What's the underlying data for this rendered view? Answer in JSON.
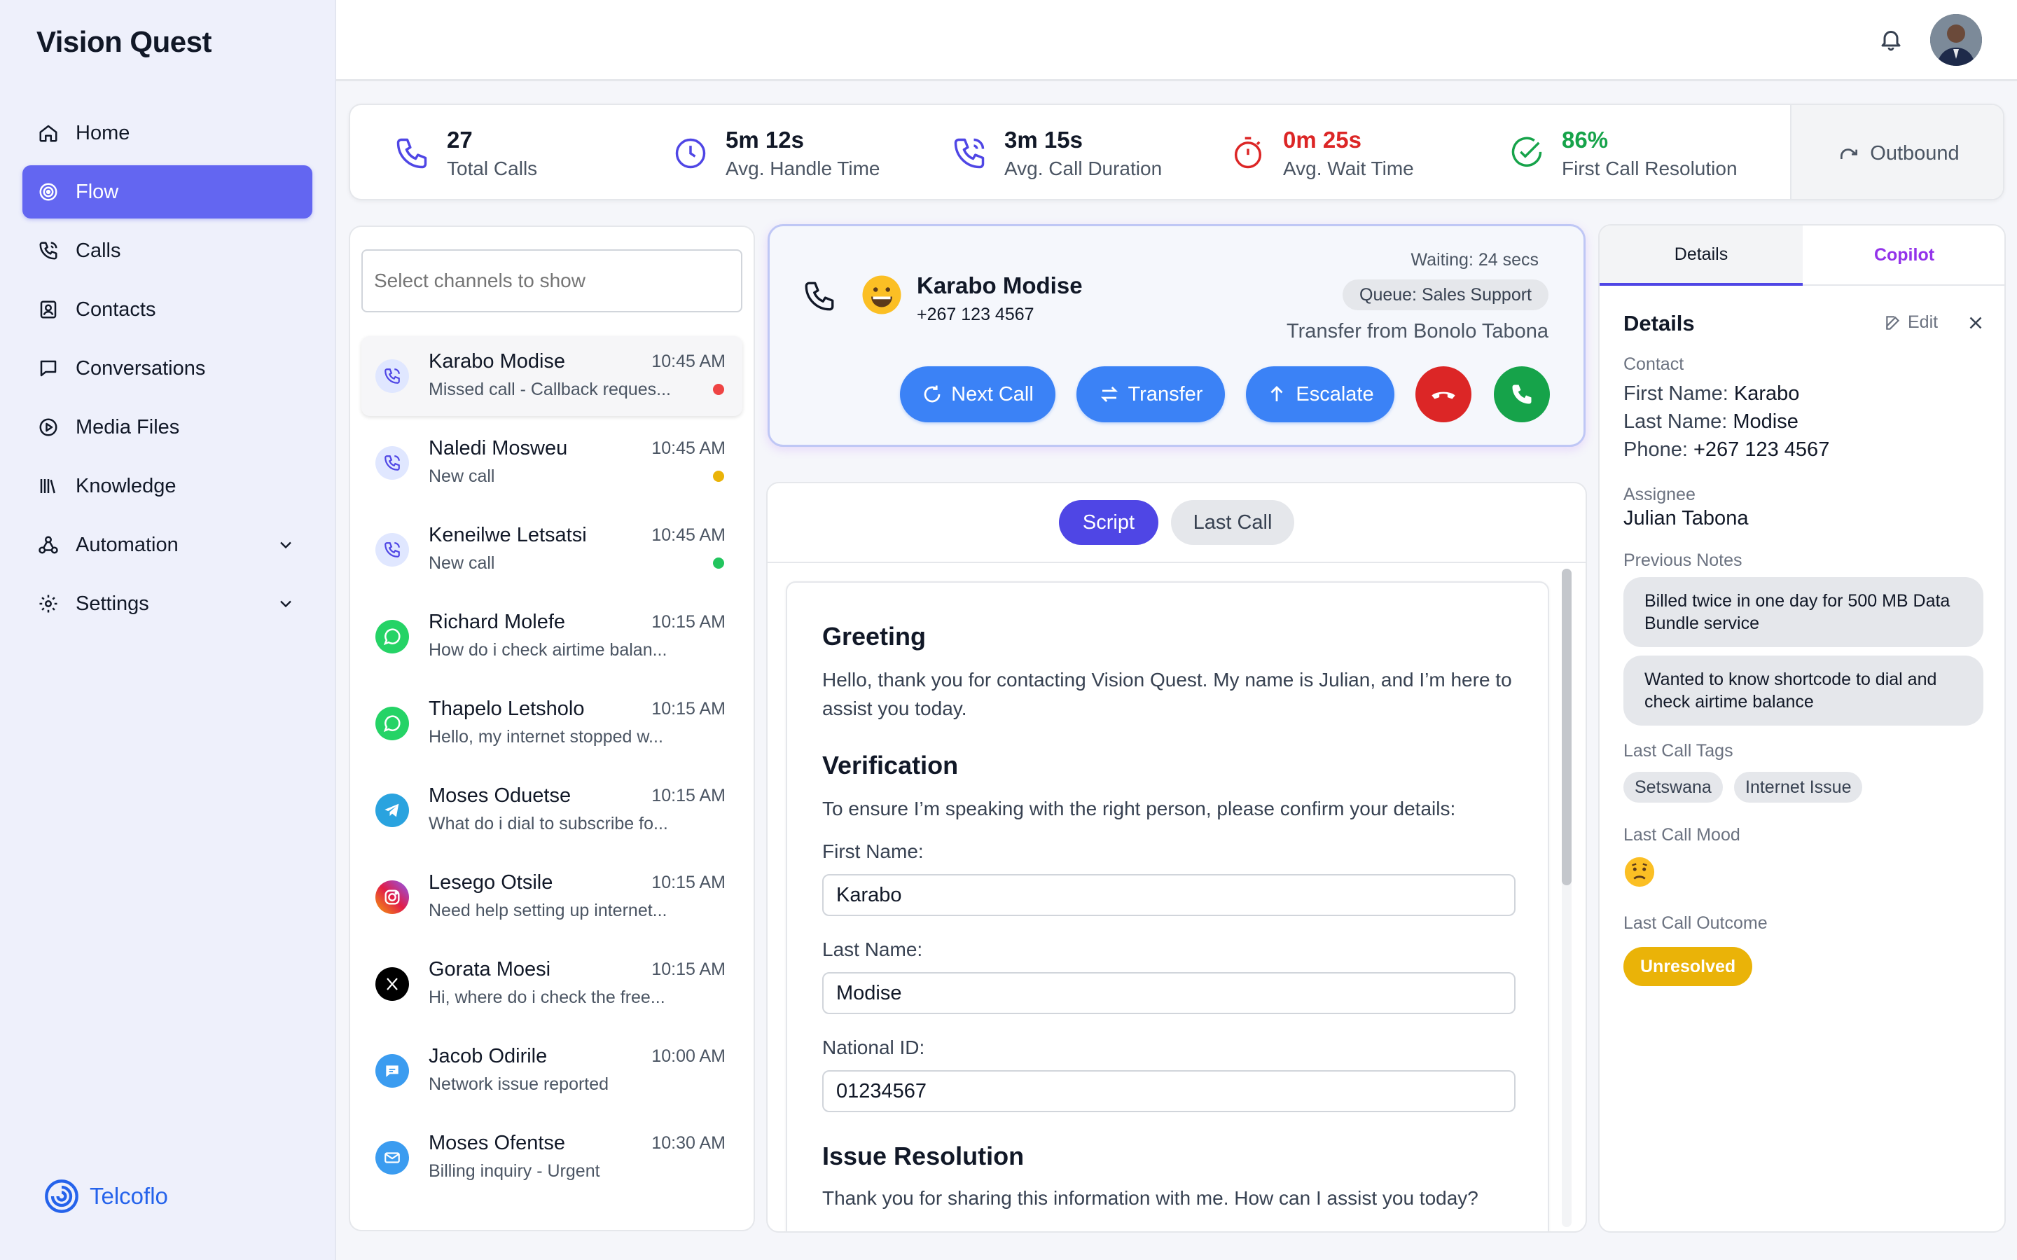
{
  "app": {
    "brand": "Vision Quest",
    "footer_brand": "Telcoflo"
  },
  "nav": [
    {
      "label": "Home",
      "icon": "home-icon"
    },
    {
      "label": "Flow",
      "icon": "flow-icon",
      "active": true
    },
    {
      "label": "Calls",
      "icon": "phone-icon"
    },
    {
      "label": "Contacts",
      "icon": "contacts-icon"
    },
    {
      "label": "Conversations",
      "icon": "chat-icon"
    },
    {
      "label": "Media Files",
      "icon": "play-icon"
    },
    {
      "label": "Knowledge",
      "icon": "library-icon"
    },
    {
      "label": "Automation",
      "icon": "automation-icon",
      "has_chevron": true
    },
    {
      "label": "Settings",
      "icon": "gear-icon",
      "has_chevron": true
    }
  ],
  "stats": [
    {
      "value": "27",
      "label": "Total Calls",
      "icon": "phone-icon",
      "color": "#4f46e5"
    },
    {
      "value": "5m 12s",
      "label": "Avg. Handle Time",
      "icon": "clock-icon",
      "color": "#4f46e5"
    },
    {
      "value": "3m 15s",
      "label": "Avg. Call Duration",
      "icon": "phone-call-icon",
      "color": "#4f46e5"
    },
    {
      "value": "0m 25s",
      "label": "Avg. Wait Time",
      "icon": "timer-icon",
      "color": "#dc2626"
    },
    {
      "value": "86%",
      "label": "First Call Resolution",
      "icon": "check-circle-icon",
      "color": "#16a34a"
    }
  ],
  "outbound_label": "Outbound",
  "channels": {
    "search_placeholder": "Select channels to show",
    "items": [
      {
        "name": "Karabo Modise",
        "time": "10:45 AM",
        "preview": "Missed call - Callback reques...",
        "channel": "call",
        "dot": "#ef4444",
        "selected": true
      },
      {
        "name": "Naledi Mosweu",
        "time": "10:45 AM",
        "preview": "New call",
        "channel": "call",
        "dot": "#eab308"
      },
      {
        "name": "Keneilwe Letsatsi",
        "time": "10:45 AM",
        "preview": "New call",
        "channel": "call",
        "dot": "#22c55e"
      },
      {
        "name": "Richard Molefe",
        "time": "10:15 AM",
        "preview": "How do i check airtime balan...",
        "channel": "whatsapp"
      },
      {
        "name": "Thapelo Letsholo",
        "time": "10:15 AM",
        "preview": "Hello, my internet stopped w...",
        "channel": "whatsapp"
      },
      {
        "name": "Moses Oduetse",
        "time": "10:15 AM",
        "preview": "What do i dial to subscribe fo...",
        "channel": "telegram"
      },
      {
        "name": "Lesego Otsile",
        "time": "10:15 AM",
        "preview": "Need help setting up internet...",
        "channel": "instagram"
      },
      {
        "name": "Gorata Moesi",
        "time": "10:15 AM",
        "preview": "Hi, where do i check the free...",
        "channel": "x"
      },
      {
        "name": "Jacob Odirile",
        "time": "10:00 AM",
        "preview": "Network issue reported",
        "channel": "sms"
      },
      {
        "name": "Moses Ofentse",
        "time": "10:30 AM",
        "preview": "Billing inquiry - Urgent",
        "channel": "email"
      }
    ]
  },
  "call": {
    "name": "Karabo Modise",
    "phone": "+267 123 4567",
    "waiting": "Waiting: 24 secs",
    "queue": "Queue: Sales Support",
    "transfer_from": "Transfer from Bonolo Tabona",
    "buttons": {
      "next": "Next Call",
      "transfer": "Transfer",
      "escalate": "Escalate"
    },
    "decline_color": "#dc2626",
    "accept_color": "#16a34a"
  },
  "script": {
    "tabs": [
      "Script",
      "Last Call"
    ],
    "active_tab": "Script",
    "greeting_h": "Greeting",
    "greeting_p": "Hello, thank you for contacting Vision Quest. My name is Julian, and I’m here to assist you today.",
    "verification_h": "Verification",
    "verification_p": "To ensure I’m speaking with the right person, please confirm your details:",
    "fields": [
      {
        "label": "First Name:",
        "value": "Karabo"
      },
      {
        "label": "Last Name:",
        "value": "Modise"
      },
      {
        "label": "National ID:",
        "value": "01234567"
      }
    ],
    "issue_h": "Issue Resolution",
    "issue_p": "Thank you for sharing this information with me. How can I assist you today?"
  },
  "details": {
    "tabs": [
      "Details",
      "Copilot"
    ],
    "heading": "Details",
    "edit_label": "Edit",
    "contact_caption": "Contact",
    "first_name_label": "First Name:",
    "first_name": "Karabo",
    "last_name_label": "Last Name:",
    "last_name": "Modise",
    "phone_label": "Phone:",
    "phone": "+267 123 4567",
    "assignee_caption": "Assignee",
    "assignee": "Julian Tabona",
    "notes_caption": "Previous Notes",
    "notes": [
      "Billed twice in one day for 500 MB Data Bundle service",
      "Wanted to know shortcode to dial and check airtime balance"
    ],
    "tags_caption": "Last Call Tags",
    "tags": [
      "Setswana",
      "Internet Issue"
    ],
    "mood_caption": "Last Call Mood",
    "mood_icon": "worried-face-icon",
    "outcome_caption": "Last Call Outcome",
    "outcome": "Unresolved",
    "outcome_color": "#eab308"
  }
}
